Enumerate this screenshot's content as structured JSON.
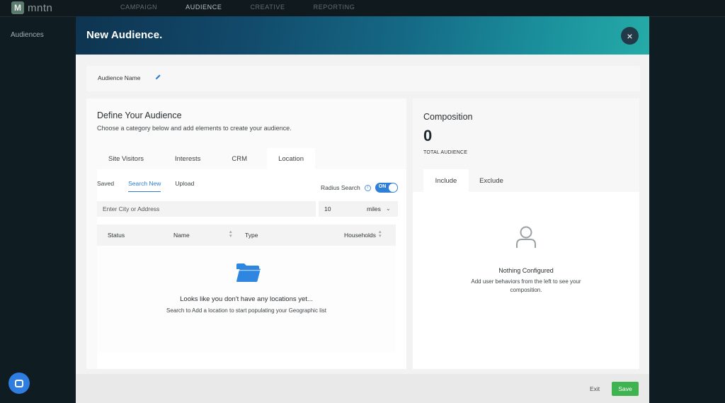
{
  "app": {
    "logo_text": "mntn",
    "logo_mark": "M",
    "nav": [
      "CAMPAIGN",
      "AUDIENCE",
      "CREATIVE",
      "REPORTING"
    ],
    "active_nav": "AUDIENCE",
    "sidebar_item": "Audiences"
  },
  "modal": {
    "title": "New Audience.",
    "close_label": "×",
    "audience_name_label": "Audience Name",
    "define": {
      "title": "Define Your Audience",
      "subtitle": "Choose a category below and add elements to create your audience.",
      "tabs": [
        "Site Visitors",
        "Interests",
        "CRM",
        "Location"
      ],
      "active_tab": "Location",
      "sub_tabs": [
        "Saved",
        "Search New",
        "Upload"
      ],
      "active_sub_tab": "Search New",
      "radius_label": "Radius Search",
      "radius_toggle": "ON",
      "city_placeholder": "Enter City or Address",
      "radius_value": "10",
      "radius_unit": "miles",
      "columns": [
        "Status",
        "Name",
        "Type",
        "Households"
      ],
      "empty_title": "Looks like you don't have any locations yet...",
      "empty_subtitle": "Search to Add a location to start populating your Geographic list"
    },
    "composition": {
      "title": "Composition",
      "count": "0",
      "count_label": "TOTAL AUDIENCE",
      "tabs": [
        "Include",
        "Exclude"
      ],
      "active_tab": "Include",
      "empty_title": "Nothing Configured",
      "empty_subtitle": "Add user behaviors from the left to see your composition."
    },
    "footer": {
      "exit_label": "Exit",
      "save_label": "Save"
    }
  },
  "colors": {
    "accent_blue": "#2e7bd1",
    "save_green": "#3fb34f",
    "folder_blue": "#2f86e0"
  }
}
